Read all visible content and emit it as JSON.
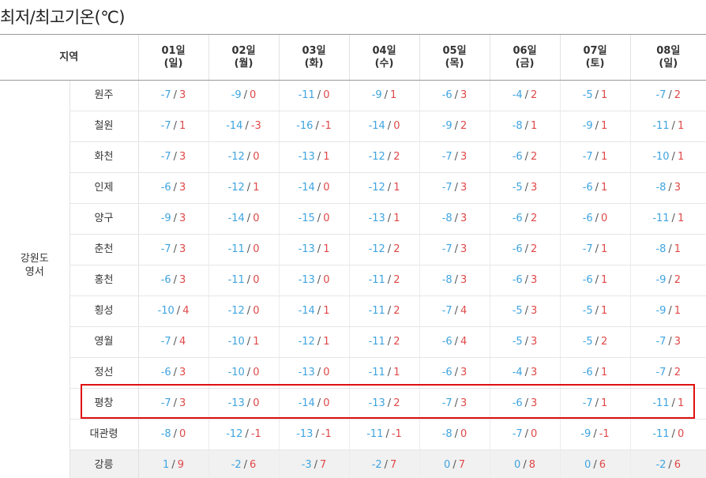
{
  "page": {
    "title": "최저/최고기온(℃)",
    "region_header": "지역",
    "region_group": [
      "강원도",
      "영서"
    ],
    "highlight_color": "#e01010"
  },
  "colors": {
    "min": "#3fa4e0",
    "max": "#e04848",
    "shaded_row": "#f1f1f1"
  },
  "days": [
    {
      "date": "01일",
      "dow": "(일)"
    },
    {
      "date": "02일",
      "dow": "(월)"
    },
    {
      "date": "03일",
      "dow": "(화)"
    },
    {
      "date": "04일",
      "dow": "(수)"
    },
    {
      "date": "05일",
      "dow": "(목)"
    },
    {
      "date": "06일",
      "dow": "(금)"
    },
    {
      "date": "07일",
      "dow": "(토)"
    },
    {
      "date": "08일",
      "dow": "(일)"
    }
  ],
  "rows": [
    {
      "city": "원주",
      "temps": [
        [
          "-7",
          "3"
        ],
        [
          "-9",
          "0"
        ],
        [
          "-11",
          "0"
        ],
        [
          "-9",
          "1"
        ],
        [
          "-6",
          "3"
        ],
        [
          "-4",
          "2"
        ],
        [
          "-5",
          "1"
        ],
        [
          "-7",
          "2"
        ]
      ]
    },
    {
      "city": "철원",
      "temps": [
        [
          "-7",
          "1"
        ],
        [
          "-14",
          "-3"
        ],
        [
          "-16",
          "-1"
        ],
        [
          "-14",
          "0"
        ],
        [
          "-9",
          "2"
        ],
        [
          "-8",
          "1"
        ],
        [
          "-9",
          "1"
        ],
        [
          "-11",
          "1"
        ]
      ]
    },
    {
      "city": "화천",
      "temps": [
        [
          "-7",
          "3"
        ],
        [
          "-12",
          "0"
        ],
        [
          "-13",
          "1"
        ],
        [
          "-12",
          "2"
        ],
        [
          "-7",
          "3"
        ],
        [
          "-6",
          "2"
        ],
        [
          "-7",
          "1"
        ],
        [
          "-10",
          "1"
        ]
      ]
    },
    {
      "city": "인제",
      "temps": [
        [
          "-6",
          "3"
        ],
        [
          "-12",
          "1"
        ],
        [
          "-14",
          "0"
        ],
        [
          "-12",
          "1"
        ],
        [
          "-7",
          "3"
        ],
        [
          "-5",
          "3"
        ],
        [
          "-6",
          "1"
        ],
        [
          "-8",
          "3"
        ]
      ]
    },
    {
      "city": "양구",
      "temps": [
        [
          "-9",
          "3"
        ],
        [
          "-14",
          "0"
        ],
        [
          "-15",
          "0"
        ],
        [
          "-13",
          "1"
        ],
        [
          "-8",
          "3"
        ],
        [
          "-6",
          "2"
        ],
        [
          "-6",
          "0"
        ],
        [
          "-11",
          "1"
        ]
      ]
    },
    {
      "city": "춘천",
      "temps": [
        [
          "-7",
          "3"
        ],
        [
          "-11",
          "0"
        ],
        [
          "-13",
          "1"
        ],
        [
          "-12",
          "2"
        ],
        [
          "-7",
          "3"
        ],
        [
          "-6",
          "2"
        ],
        [
          "-7",
          "1"
        ],
        [
          "-8",
          "1"
        ]
      ]
    },
    {
      "city": "홍천",
      "temps": [
        [
          "-6",
          "3"
        ],
        [
          "-11",
          "0"
        ],
        [
          "-13",
          "0"
        ],
        [
          "-11",
          "2"
        ],
        [
          "-8",
          "3"
        ],
        [
          "-6",
          "3"
        ],
        [
          "-6",
          "1"
        ],
        [
          "-9",
          "2"
        ]
      ]
    },
    {
      "city": "횡성",
      "temps": [
        [
          "-10",
          "4"
        ],
        [
          "-12",
          "0"
        ],
        [
          "-14",
          "1"
        ],
        [
          "-11",
          "2"
        ],
        [
          "-7",
          "4"
        ],
        [
          "-5",
          "3"
        ],
        [
          "-5",
          "1"
        ],
        [
          "-9",
          "1"
        ]
      ]
    },
    {
      "city": "영월",
      "temps": [
        [
          "-7",
          "4"
        ],
        [
          "-10",
          "1"
        ],
        [
          "-12",
          "1"
        ],
        [
          "-11",
          "2"
        ],
        [
          "-6",
          "4"
        ],
        [
          "-5",
          "3"
        ],
        [
          "-5",
          "2"
        ],
        [
          "-7",
          "3"
        ]
      ]
    },
    {
      "city": "정선",
      "temps": [
        [
          "-6",
          "3"
        ],
        [
          "-10",
          "0"
        ],
        [
          "-13",
          "0"
        ],
        [
          "-11",
          "1"
        ],
        [
          "-6",
          "3"
        ],
        [
          "-4",
          "3"
        ],
        [
          "-6",
          "1"
        ],
        [
          "-7",
          "2"
        ]
      ]
    },
    {
      "city": "평창",
      "highlighted": true,
      "temps": [
        [
          "-7",
          "3"
        ],
        [
          "-13",
          "0"
        ],
        [
          "-14",
          "0"
        ],
        [
          "-13",
          "2"
        ],
        [
          "-7",
          "3"
        ],
        [
          "-6",
          "3"
        ],
        [
          "-7",
          "1"
        ],
        [
          "-11",
          "1"
        ]
      ]
    },
    {
      "city": "대관령",
      "temps": [
        [
          "-8",
          "0"
        ],
        [
          "-12",
          "-1"
        ],
        [
          "-13",
          "-1"
        ],
        [
          "-11",
          "-1"
        ],
        [
          "-8",
          "0"
        ],
        [
          "-7",
          "0"
        ],
        [
          "-9",
          "-1"
        ],
        [
          "-11",
          "0"
        ]
      ]
    },
    {
      "city": "강릉",
      "shaded": true,
      "temps": [
        [
          "1",
          "9"
        ],
        [
          "-2",
          "6"
        ],
        [
          "-3",
          "7"
        ],
        [
          "-2",
          "7"
        ],
        [
          "0",
          "7"
        ],
        [
          "0",
          "8"
        ],
        [
          "0",
          "6"
        ],
        [
          "-2",
          "6"
        ]
      ]
    }
  ]
}
